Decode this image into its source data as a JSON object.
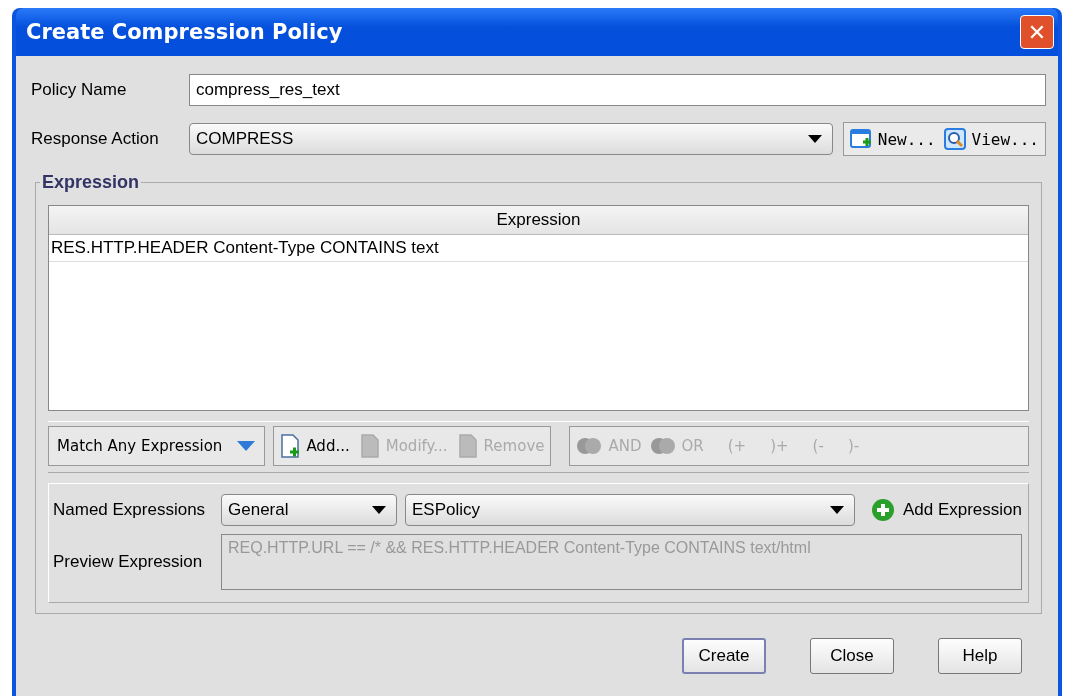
{
  "window": {
    "title": "Create Compression Policy",
    "close": "✕"
  },
  "policy_name": {
    "label": "Policy Name",
    "value": "compress_res_text"
  },
  "response_action": {
    "label": "Response Action",
    "value": "COMPRESS",
    "buttons": [
      {
        "label": "New...",
        "kind": "new"
      },
      {
        "label": "View...",
        "kind": "view"
      }
    ]
  },
  "expression_group": {
    "title": "Expression",
    "table": {
      "columns": [
        "Expression"
      ],
      "rows": [
        {
          "cells": [
            "RES.HTTP.HEADER Content-Type CONTAINS text"
          ],
          "selected": false
        }
      ]
    },
    "match_button": {
      "label": "Match Any Expression"
    },
    "edit_buttons": [
      {
        "label": "Add...",
        "kind": "add",
        "disabled": false
      },
      {
        "label": "Modify...",
        "kind": "modify",
        "disabled": true
      },
      {
        "label": "Remove",
        "kind": "remove",
        "disabled": true
      }
    ],
    "logic_buttons": [
      {
        "label": "AND",
        "kind": "icon",
        "disabled": true
      },
      {
        "label": "OR",
        "kind": "icon",
        "disabled": true
      },
      {
        "label": "(+",
        "kind": "text",
        "disabled": true
      },
      {
        "label": ")+",
        "kind": "text",
        "disabled": true
      },
      {
        "label": "(-",
        "kind": "text",
        "disabled": true
      },
      {
        "label": ")-",
        "kind": "text",
        "disabled": true
      }
    ],
    "named_expressions": {
      "label": "Named Expressions",
      "category": "General",
      "expression": "ESPolicy",
      "add_button": "Add Expression"
    },
    "preview": {
      "label": "Preview Expression",
      "value": "REQ.HTTP.URL == /* && RES.HTTP.HEADER Content-Type CONTAINS text/html"
    }
  },
  "footer_buttons": [
    {
      "label": "Create",
      "default": true
    },
    {
      "label": "Close",
      "default": false
    },
    {
      "label": "Help",
      "default": false
    }
  ]
}
